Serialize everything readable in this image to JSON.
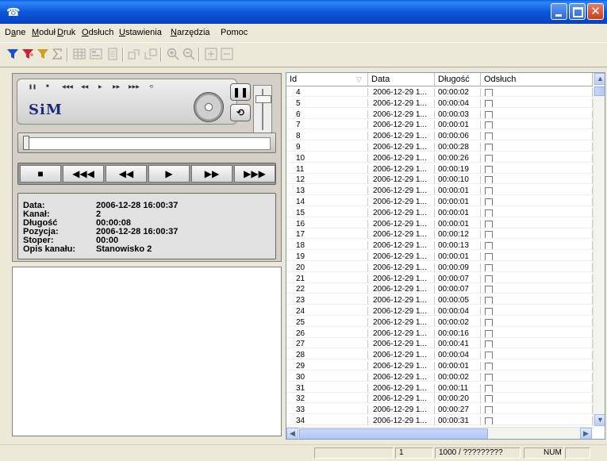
{
  "window": {
    "app_icon": "phone-icon"
  },
  "menu": [
    {
      "pre": "D",
      "u": "a",
      "post": "ne"
    },
    {
      "pre": "",
      "u": "M",
      "post": "oduł"
    },
    {
      "pre": "",
      "u": "D",
      "post": "ruk"
    },
    {
      "pre": "",
      "u": "O",
      "post": "dsłuch"
    },
    {
      "pre": "",
      "u": "U",
      "post": "stawienia"
    },
    {
      "pre": "",
      "u": "N",
      "post": "arzędzia"
    },
    {
      "pre": "Pomoc",
      "u": "",
      "post": ""
    }
  ],
  "player": {
    "logo": "SiM",
    "pause_glyph": "❚❚",
    "loop_glyph": "⟲",
    "transport": [
      "■",
      "◀◀◀",
      "◀◀",
      "▶",
      "▶▶",
      "▶▶▶"
    ],
    "info": [
      {
        "label": "Data:",
        "value": "2006-12-28 16:00:37"
      },
      {
        "label": "Kanał:",
        "value": "2"
      },
      {
        "label": "Długość",
        "value": "00:00:08"
      },
      {
        "label": "Pozycja:",
        "value": "2006-12-28 16:00:37"
      },
      {
        "label": "Stoper:",
        "value": "00:00"
      },
      {
        "label": "Opis kanału:",
        "value": "Stanowisko 2"
      }
    ]
  },
  "grid": {
    "headers": {
      "id": "Id",
      "date": "Data",
      "len": "Długość",
      "ods": "Odsłuch"
    },
    "rows": [
      {
        "id": "4",
        "date": "2006-12-29 1...",
        "len": "00:00:02"
      },
      {
        "id": "5",
        "date": "2006-12-29 1...",
        "len": "00:00:04"
      },
      {
        "id": "6",
        "date": "2006-12-29 1...",
        "len": "00:00:03"
      },
      {
        "id": "7",
        "date": "2006-12-29 1...",
        "len": "00:00:01"
      },
      {
        "id": "8",
        "date": "2006-12-29 1...",
        "len": "00:00:06"
      },
      {
        "id": "9",
        "date": "2006-12-29 1...",
        "len": "00:00:28"
      },
      {
        "id": "10",
        "date": "2006-12-29 1...",
        "len": "00:00:26"
      },
      {
        "id": "11",
        "date": "2006-12-29 1...",
        "len": "00:00:19"
      },
      {
        "id": "12",
        "date": "2006-12-29 1...",
        "len": "00:00:10"
      },
      {
        "id": "13",
        "date": "2006-12-29 1...",
        "len": "00:00:01"
      },
      {
        "id": "14",
        "date": "2006-12-29 1...",
        "len": "00:00:01"
      },
      {
        "id": "15",
        "date": "2006-12-29 1...",
        "len": "00:00:01"
      },
      {
        "id": "16",
        "date": "2006-12-29 1...",
        "len": "00:00:01"
      },
      {
        "id": "17",
        "date": "2006-12-29 1...",
        "len": "00:00:12"
      },
      {
        "id": "18",
        "date": "2006-12-29 1...",
        "len": "00:00:13"
      },
      {
        "id": "19",
        "date": "2006-12-29 1...",
        "len": "00:00:01"
      },
      {
        "id": "20",
        "date": "2006-12-29 1...",
        "len": "00:00:09"
      },
      {
        "id": "21",
        "date": "2006-12-29 1...",
        "len": "00:00:07"
      },
      {
        "id": "22",
        "date": "2006-12-29 1...",
        "len": "00:00:07"
      },
      {
        "id": "23",
        "date": "2006-12-29 1...",
        "len": "00:00:05"
      },
      {
        "id": "24",
        "date": "2006-12-29 1...",
        "len": "00:00:04"
      },
      {
        "id": "25",
        "date": "2006-12-29 1...",
        "len": "00:00:02"
      },
      {
        "id": "26",
        "date": "2006-12-29 1...",
        "len": "00:00:16"
      },
      {
        "id": "27",
        "date": "2006-12-29 1...",
        "len": "00:00:41"
      },
      {
        "id": "28",
        "date": "2006-12-29 1...",
        "len": "00:00:04"
      },
      {
        "id": "29",
        "date": "2006-12-29 1...",
        "len": "00:00:01"
      },
      {
        "id": "30",
        "date": "2006-12-29 1...",
        "len": "00:00:02"
      },
      {
        "id": "31",
        "date": "2006-12-29 1...",
        "len": "00:00:11"
      },
      {
        "id": "32",
        "date": "2006-12-29 1...",
        "len": "00:00:20"
      },
      {
        "id": "33",
        "date": "2006-12-29 1...",
        "len": "00:00:27"
      },
      {
        "id": "34",
        "date": "2006-12-29 1...",
        "len": "00:00:31"
      }
    ]
  },
  "status": {
    "page": "1",
    "count": "1000 / ?????????",
    "num": "NUM"
  },
  "colors": {
    "titlebar": "#0c58d8",
    "close": "#c6401c",
    "logo": "#1b2b7a"
  }
}
